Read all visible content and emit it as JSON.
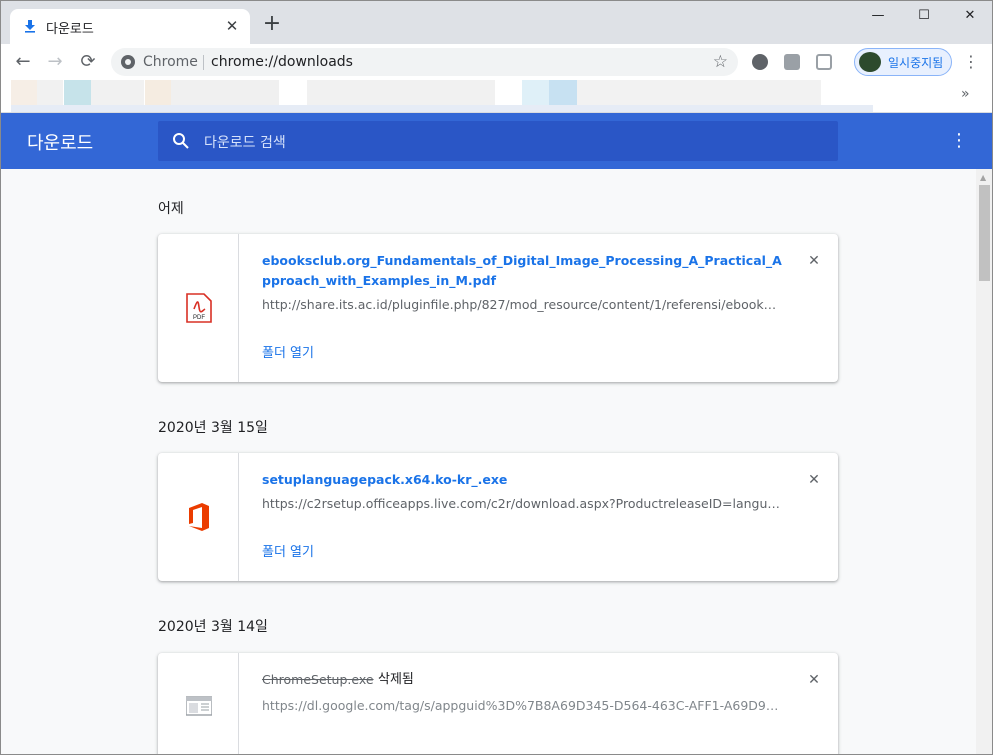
{
  "tab": {
    "title": "다운로드",
    "close": "✕"
  },
  "newtab": "+",
  "window_controls": {
    "minimize": "—",
    "maximize": "☐",
    "close": "✕"
  },
  "toolbar": {
    "back": "←",
    "forward": "→",
    "reload": "⟳",
    "chip": "Chrome",
    "url": "chrome://downloads",
    "star": "☆",
    "profile_label": "일시중지됨",
    "menu": "⋮"
  },
  "bookmarks_overflow": "»",
  "downloads": {
    "title": "다운로드",
    "search_placeholder": "다운로드 검색",
    "more": "⋮",
    "groups": [
      {
        "date": "어제",
        "items": [
          {
            "name": "ebooksclub.org_Fundamentals_of_Digital_Image_Processing_A_Practical_Approach_with_Examples_in_M.pdf",
            "url": "http://share.its.ac.id/pluginfile.php/827/mod_resource/content/1/referensi/ebookscl...",
            "action": "폴더 열기",
            "icon": "pdf-icon"
          }
        ]
      },
      {
        "date": "2020년 3월 15일",
        "items": [
          {
            "name": "setuplanguagepack.x64.ko-kr_.exe",
            "url": "https://c2rsetup.officeapps.live.com/c2r/download.aspx?ProductreleaseID=languag...",
            "action": "폴더 열기",
            "icon": "office-icon"
          }
        ]
      },
      {
        "date": "2020년 3월 14일",
        "items": [
          {
            "name": "ChromeSetup.exe",
            "status": "삭제됨",
            "url": "https://dl.google.com/tag/s/appguid%3D%7B8A69D345-D564-463C-AFF1-A69D9E53...",
            "icon": "generic-file-icon"
          }
        ]
      }
    ],
    "remove": "✕"
  },
  "colors": {
    "accent": "#3367d6",
    "search_bg": "#2a56c6",
    "link": "#1a73e8"
  }
}
